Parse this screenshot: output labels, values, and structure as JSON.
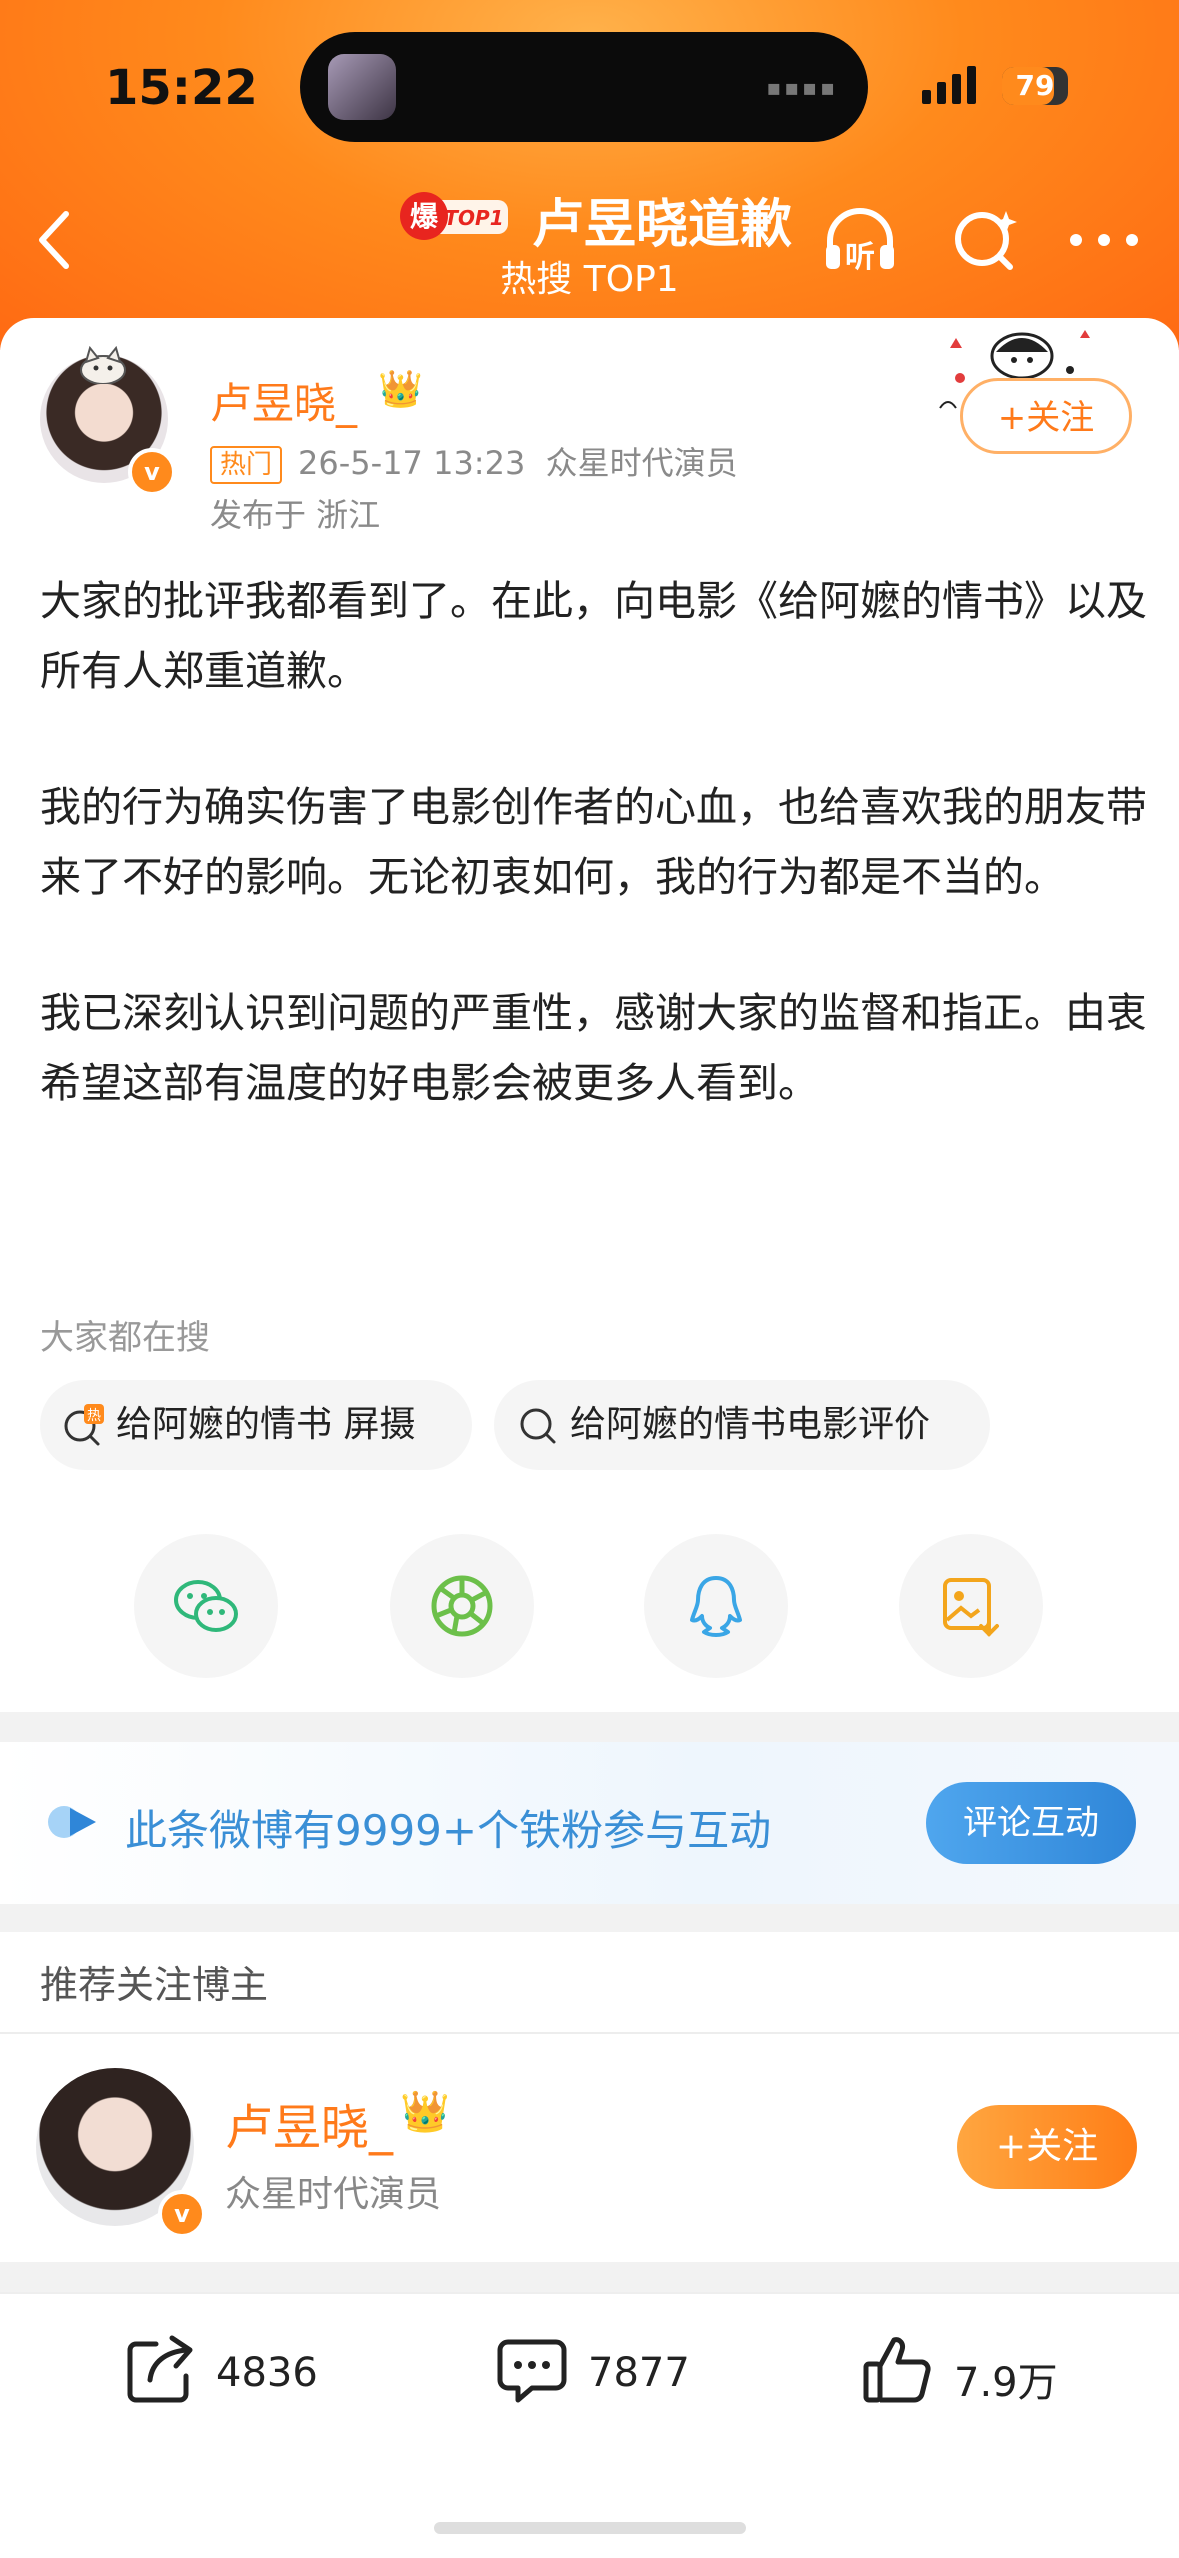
{
  "status": {
    "time": "15:22",
    "battery": "79",
    "battery_level": 0.79
  },
  "nav": {
    "badge_char": "爆",
    "badge_tag": "TOP1",
    "title": "卢昱晓道歉",
    "subtitle": "热搜 TOP1",
    "listen_label": "听"
  },
  "post": {
    "author": "卢昱晓_",
    "tag": "热门",
    "datetime": "26-5-17 13:23",
    "source": "众星时代演员",
    "location": "发布于 浙江",
    "follow": "+关注",
    "paragraphs": [
      "大家的批评我都看到了。在此，向电影《给阿嬷的情书》以及所有人郑重道歉。",
      "我的行为确实伤害了电影创作者的心血，也给喜欢我的朋友带来了不好的影响。无论初衷如何，我的行为都是不当的。",
      "我已深刻认识到问题的严重性，感谢大家的监督和指正。由衷希望这部有温度的好电影会被更多人看到。"
    ]
  },
  "search": {
    "title": "大家都在搜",
    "chips": [
      "给阿嬷的情书 屏摄",
      "给阿嬷的情书电影评价"
    ]
  },
  "share": [
    "wechat-icon",
    "moments-icon",
    "qq-icon",
    "save-image-icon"
  ],
  "fans": {
    "text": "此条微博有9999+个铁粉参与互动",
    "button": "评论互动"
  },
  "recommend": {
    "title": "推荐关注博主",
    "name": "卢昱晓_",
    "desc": "众星时代演员",
    "follow": "+关注"
  },
  "actions": {
    "reposts": "4836",
    "comments": "7877",
    "likes": "7.9万"
  },
  "colors": {
    "brand_orange": "#ff7a1a",
    "link_blue": "#3a8fd6"
  }
}
